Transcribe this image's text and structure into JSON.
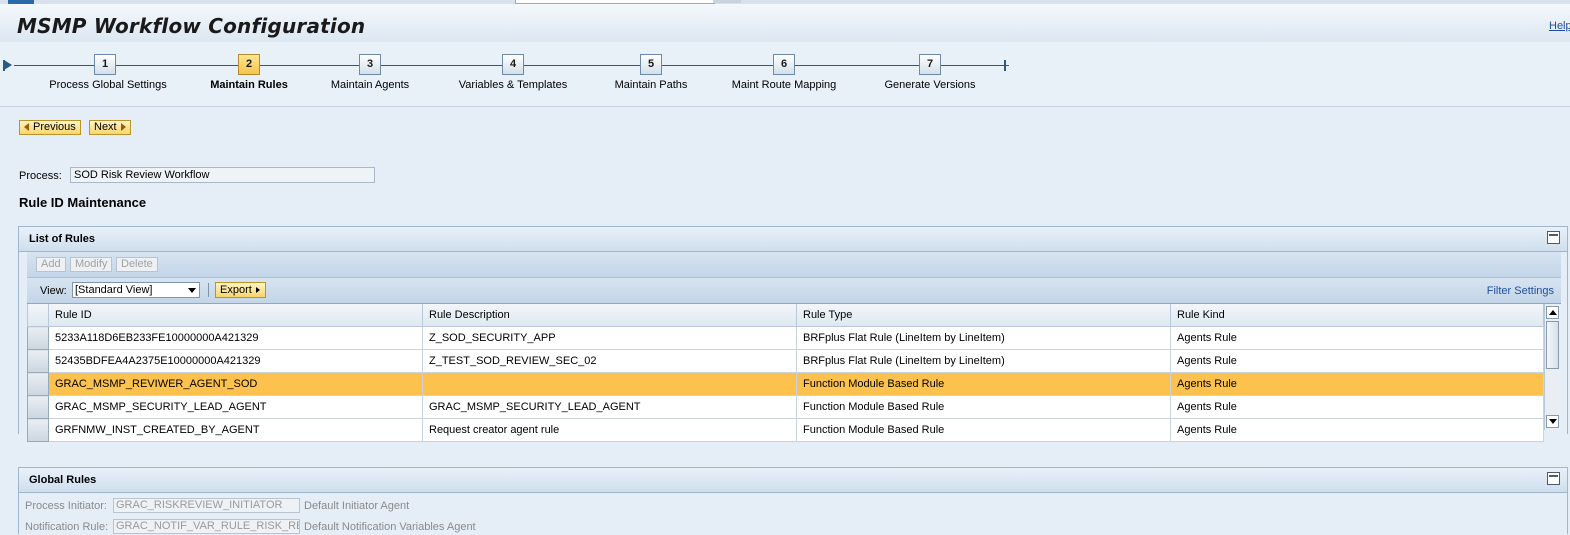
{
  "app": {
    "title": "MSMP Workflow Configuration",
    "help": "Help"
  },
  "roadmap": {
    "steps": [
      {
        "num": "1",
        "label": "Process Global Settings"
      },
      {
        "num": "2",
        "label": "Maintain Rules",
        "active": true
      },
      {
        "num": "3",
        "label": "Maintain Agents"
      },
      {
        "num": "4",
        "label": "Variables & Templates"
      },
      {
        "num": "5",
        "label": "Maintain Paths"
      },
      {
        "num": "6",
        "label": "Maint Route Mapping"
      },
      {
        "num": "7",
        "label": "Generate Versions"
      }
    ]
  },
  "nav": {
    "previous": "Previous",
    "next": "Next"
  },
  "process": {
    "label": "Process:",
    "value": "SOD Risk Review Workflow"
  },
  "section_title": "Rule ID Maintenance",
  "list_panel": {
    "title": "List of Rules",
    "buttons": {
      "add": "Add",
      "modify": "Modify",
      "delete": "Delete"
    },
    "view_label": "View:",
    "view_value": "[Standard View]",
    "export": "Export",
    "filter_settings": "Filter Settings",
    "columns": [
      "Rule ID",
      "Rule Description",
      "Rule Type",
      "Rule Kind"
    ],
    "rows": [
      {
        "id": "5233A118D6EB233FE10000000A421329",
        "desc": "Z_SOD_SECURITY_APP",
        "type": "BRFplus Flat Rule (LineItem by LineItem)",
        "kind": "Agents Rule"
      },
      {
        "id": "52435BDFEA4A2375E10000000A421329",
        "desc": "Z_TEST_SOD_REVIEW_SEC_02",
        "type": "BRFplus Flat Rule (LineItem by LineItem)",
        "kind": "Agents Rule"
      },
      {
        "id": "GRAC_MSMP_REVIWER_AGENT_SOD",
        "desc": "",
        "type": "Function Module Based Rule",
        "kind": "Agents Rule",
        "selected": true
      },
      {
        "id": "GRAC_MSMP_SECURITY_LEAD_AGENT",
        "desc": "GRAC_MSMP_SECURITY_LEAD_AGENT",
        "type": "Function Module Based Rule",
        "kind": "Agents Rule"
      },
      {
        "id": "GRFNMW_INST_CREATED_BY_AGENT",
        "desc": "Request creator agent rule",
        "type": "Function Module Based Rule",
        "kind": "Agents Rule"
      }
    ]
  },
  "global_panel": {
    "title": "Global Rules",
    "initiator_label": "Process Initiator:",
    "initiator_value": "GRAC_RISKREVIEW_INITIATOR",
    "initiator_desc": "Default Initiator Agent",
    "notif_label": "Notification Rule:",
    "notif_value": "GRAC_NOTIF_VAR_RULE_RISK_REV",
    "notif_desc": "Default Notification Variables Agent"
  },
  "colors": {
    "selected_row": "#fdc24d",
    "active_step": "#f5c54a",
    "link": "#1f4f9d"
  }
}
